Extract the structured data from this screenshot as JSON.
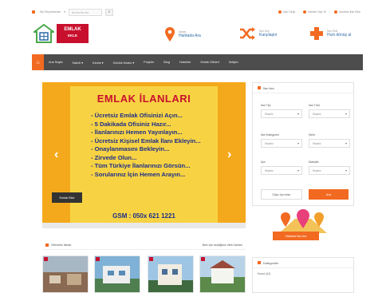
{
  "topbar": {
    "favorites": "Sık Seçmeleriniz",
    "search_placeholder": "Ne Ara Ne Ara",
    "links": [
      "Üye Girişi",
      "Hemen Üye Ol",
      "Ücretsiz İlan Ekle"
    ]
  },
  "logo": {
    "line1": "EMLAK",
    "line2": "EKLE"
  },
  "header": {
    "location": {
      "small": "İlanlar",
      "big": "Haritada Ara"
    },
    "compare": {
      "small": "İlan Seç",
      "big": "Karşılaştır"
    },
    "add": {
      "small": "İlan Ekle",
      "big": "Hızlı dönüş al"
    }
  },
  "nav": [
    "Ana Sayfa",
    "Satılık ▾",
    "Kiralık ▾",
    "Günlük Kiralık ▾",
    "Projeler",
    "Blog",
    "Haberler",
    "Emlak Ofisleri",
    "İletişim"
  ],
  "slider": {
    "title": "EMLAK İLANLARI",
    "lines": [
      "- Ücretsiz Emlak Ofisinizi Açın...",
      "- 5 Dakikada Ofisiniz Hazır...",
      "- İlanlarınızı Hemen Yayınlayın...",
      "- Ücretsiz Kişisel Emlak İlanı Ekleyin...",
      "- Onaylanmasını Bekleyin...",
      "- Zirvede Olun...",
      "- Tüm Türkiye İlanlarınızı Görsün...",
      "- Sorularınız İçin Hemen Arayın..."
    ],
    "phone": "GSM : 050x 621 1221",
    "button": "Emlak Ekle",
    "prev": "‹",
    "next": "›"
  },
  "search": {
    "title": "İlan Ara",
    "fields": [
      {
        "label": "İlan Tipi",
        "value": "Seçiniz"
      },
      {
        "label": "İlan Türü",
        "value": "Seçiniz"
      },
      {
        "label": "İlan Kategorisi",
        "value": "Seçiniz"
      },
      {
        "label": "Şehir",
        "value": "Seçiniz"
      },
      {
        "label": "İlçe",
        "value": "Seçiniz"
      },
      {
        "label": "Mahalle",
        "value": "Seçiniz"
      }
    ],
    "advanced": "Diğer Ayrıntılar",
    "submit": "Ara"
  },
  "map_button": "Haritada İlan Ara",
  "listings": {
    "title": "Vitrindeki İlanlar",
    "more": "Bize için seçtiğimiz vitrin ilanları"
  },
  "categories": {
    "title": "Kategoriler",
    "first": "Konut (42)"
  },
  "colors": {
    "accent": "#f26a21",
    "brand_red": "#c8102e",
    "nav": "#4d4d4d",
    "slider_bg": "#f4a91c"
  }
}
